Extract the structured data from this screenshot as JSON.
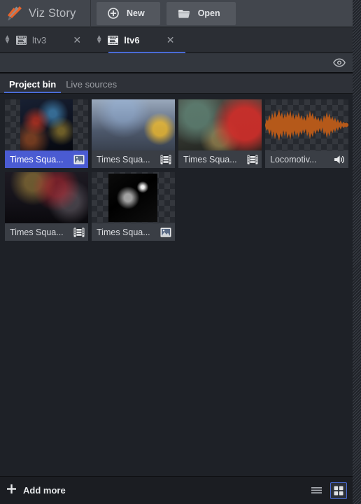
{
  "app": {
    "name": "Viz Story",
    "logo_icon": "viz-logo-icon"
  },
  "titlebar": {
    "new_button": {
      "label": "New",
      "icon": "plus-circle-icon"
    },
    "open_button": {
      "label": "Open",
      "icon": "folder-icon"
    }
  },
  "tabs": [
    {
      "label": "ltv3",
      "icon": "storyboard-icon",
      "close_icon": "close-icon",
      "grip_icon": "reorder-grip-icon",
      "active": false
    },
    {
      "label": "ltv6",
      "icon": "storyboard-icon",
      "close_icon": "close-icon",
      "grip_icon": "reorder-grip-icon",
      "active": true
    }
  ],
  "subtoolbar": {
    "preview_toggle": {
      "icon": "eye-icon"
    }
  },
  "panel_tabs": [
    {
      "label": "Project bin",
      "active": true
    },
    {
      "label": "Live sources",
      "active": false
    }
  ],
  "bin": {
    "items": [
      {
        "label": "Times Squa...",
        "type_icon": "image-icon",
        "selected": true,
        "transparent": true,
        "art": "art-ts1"
      },
      {
        "label": "Times Squa...",
        "type_icon": "video-icon",
        "selected": false,
        "transparent": false,
        "art": "art-ts2"
      },
      {
        "label": "Times Squa...",
        "type_icon": "video-icon",
        "selected": false,
        "transparent": false,
        "art": "art-ts3"
      },
      {
        "label": "Locomotiv...",
        "type_icon": "audio-icon",
        "selected": false,
        "transparent": true,
        "art": "art-audio"
      },
      {
        "label": "Times Squa...",
        "type_icon": "video-icon",
        "selected": false,
        "transparent": false,
        "art": "art-ts5"
      },
      {
        "label": "Times Squa...",
        "type_icon": "image-icon",
        "selected": false,
        "transparent": true,
        "art": "art-ts6"
      }
    ]
  },
  "footer": {
    "add_more": {
      "label": "Add more",
      "icon": "plus-icon"
    },
    "view_list": {
      "icon": "list-view-icon",
      "active": false
    },
    "view_grid": {
      "icon": "grid-view-icon",
      "active": true
    }
  },
  "colors": {
    "accent_blue": "#4a6bd6",
    "selection_blue": "#4a5bd2",
    "titlebar_bg": "#42464d",
    "panel_bg": "#1e2127",
    "label_bg": "#3a3e45",
    "logo_orange": "#e8632a",
    "waveform_orange": "#b5591a"
  }
}
